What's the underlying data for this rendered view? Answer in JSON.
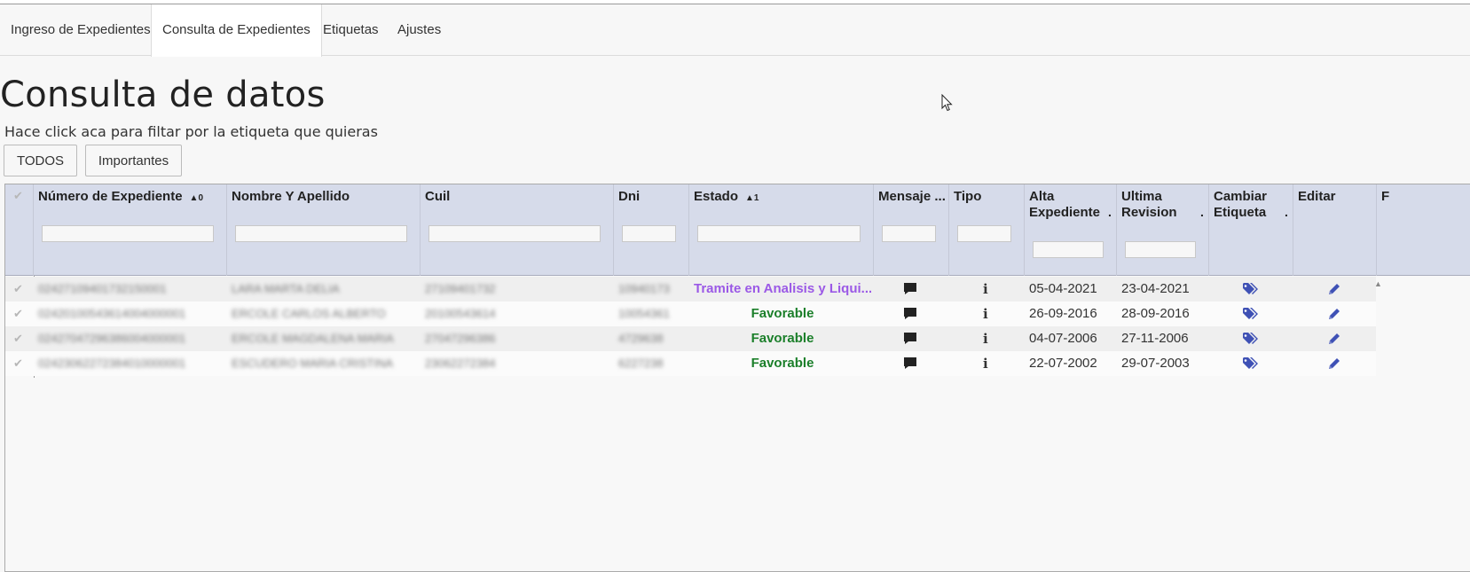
{
  "tabs": [
    {
      "label": "Ingreso de Expedientes"
    },
    {
      "label": "Consulta de Expedientes"
    },
    {
      "label": "Etiquetas"
    },
    {
      "label": "Ajustes"
    }
  ],
  "page": {
    "title": "Consulta de datos",
    "hint": "Hace click aca para filtar por la etiqueta que quieras"
  },
  "filters": {
    "todos": "TODOS",
    "importantes": "Importantes"
  },
  "grid": {
    "columns": {
      "numero": "Número de Expediente",
      "numero_sort": "0",
      "nombre": "Nombre Y Apellido",
      "cuil": "Cuil",
      "dni": "Dni",
      "estado": "Estado",
      "estado_sort": "1",
      "mensaje": "Mensaje ...",
      "tipo": "Tipo",
      "alta_1": "Alta",
      "alta_2": "Expediente",
      "ultima_1": "Ultima",
      "ultima_2": "Revision",
      "cambiar_1": "Cambiar",
      "cambiar_2": "Etiqueta",
      "editar": "Editar",
      "extra": "F"
    },
    "rows": [
      {
        "numero": "02427109401732150001",
        "nombre": "LARA MARTA DELIA",
        "cuil": "27109401732",
        "dni": "10940173",
        "estado": "Tramite en Analisis y Liqui...",
        "estado_kind": "tramite",
        "tipo": "i",
        "alta": "05-04-2021",
        "ultima": "23-04-2021"
      },
      {
        "numero": "02420100543614004000001",
        "nombre": "ERCOLE CARLOS ALBERTO",
        "cuil": "20100543614",
        "dni": "10054361",
        "estado": "Favorable",
        "estado_kind": "favorable",
        "tipo": "i",
        "alta": "26-09-2016",
        "ultima": "28-09-2016"
      },
      {
        "numero": "02427047296386004000001",
        "nombre": "ERCOLE MAGDALENA MARIA",
        "cuil": "27047296386",
        "dni": "4729638",
        "estado": "Favorable",
        "estado_kind": "favorable",
        "tipo": "i",
        "alta": "04-07-2006",
        "ultima": "27-11-2006"
      },
      {
        "numero": "02423062272384010000001",
        "nombre": "ESCUDERO MARIA CRISTINA",
        "cuil": "23062272384",
        "dni": "6227238",
        "estado": "Favorable",
        "estado_kind": "favorable",
        "tipo": "i",
        "alta": "22-07-2002",
        "ultima": "29-07-2003"
      }
    ]
  },
  "icons": {
    "check": "check-icon",
    "message": "message-bubble-icon",
    "tag": "tags-icon",
    "edit": "pencil-icon"
  },
  "colors": {
    "header_bg": "#d6dbea",
    "tramite": "#9b59e6",
    "favorable": "#1b7f2a",
    "icon_blue": "#3f51b5"
  }
}
